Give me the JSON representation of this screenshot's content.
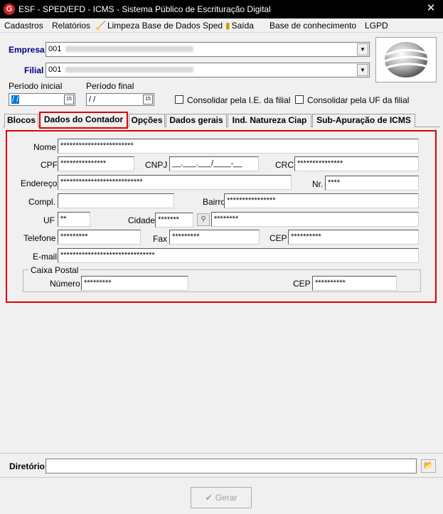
{
  "window": {
    "title": "ESF - SPED/EFD - ICMS - Sistema Público de Escrituração Digital",
    "icon_letter": "G",
    "close_glyph": "✕"
  },
  "menu": {
    "cadastros": "Cadastros",
    "relatorios": "Relatórios",
    "limpeza": "Limpeza Base de Dados Sped",
    "saida": "Saída",
    "base_conhecimento": "Base de conhecimento",
    "lgpd": "LGPD"
  },
  "header": {
    "empresa_label": "Empresa",
    "empresa_code": "001",
    "filial_label": "Filial",
    "filial_code": "001",
    "periodo_inicial_label": "Período inicial",
    "periodo_inicial_value": "/ /",
    "periodo_final_label": "Período final",
    "periodo_final_value": "/ /",
    "consolidar_ie_label": "Consolidar pela I.E. da filial",
    "consolidar_uf_label": "Consolidar pela UF da filial",
    "calendar_glyph": "15"
  },
  "tabs": [
    {
      "label": "Blocos"
    },
    {
      "label": "Dados do Contador"
    },
    {
      "label": "Opções"
    },
    {
      "label": "Dados gerais"
    },
    {
      "label": "Ind. Natureza Ciap"
    },
    {
      "label": "Sub-Apuração de ICMS"
    }
  ],
  "contador": {
    "nome_label": "Nome",
    "nome_value": "************************",
    "cpf_label": "CPF",
    "cpf_value": "***************",
    "cnpj_label": "CNPJ",
    "cnpj_value": "__.___.___/____-__",
    "crc_label": "CRC",
    "crc_value": "***************",
    "endereco_label": "Endereço",
    "endereco_value": "***************************",
    "nr_label": "Nr.",
    "nr_value": "****",
    "compl_label": "Compl.",
    "compl_value": "",
    "bairro_label": "Bairro",
    "bairro_value": "****************",
    "uf_label": "UF",
    "uf_value": "**",
    "cidade_label": "Cidade",
    "cidade_code": "*******",
    "cidade_name": "********",
    "telefone_label": "Telefone",
    "telefone_value": "*********",
    "fax_label": "Fax",
    "fax_value": "*********",
    "cep_label": "CEP",
    "cep_value": "**********",
    "email_label": "E-mail",
    "email_value": "*******************************",
    "caixa_postal_label": "Caixa Postal",
    "numero_label": "Número",
    "numero_value": "*********",
    "cx_cep_label": "CEP",
    "cx_cep_value": "**********"
  },
  "footer": {
    "diretorio_label": "Diretório",
    "diretorio_value": "",
    "gerar_label": "Gerar",
    "check_glyph": "✔",
    "folder_glyph": "📂"
  },
  "colors": {
    "highlight_red": "#e00000",
    "title_bg": "#000000",
    "window_bg": "#f0f0f0",
    "selection_blue": "#0078d7"
  }
}
